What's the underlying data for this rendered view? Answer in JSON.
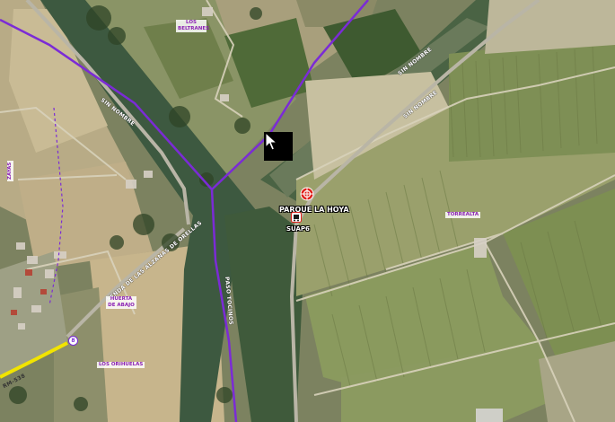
{
  "map": {
    "road_labels": {
      "sin_nombre_1": "SIN NOMBRE",
      "sin_nombre_2": "SIN NOMBRE",
      "sin_nombre_3": "SIN NOMBRE",
      "paso_tocinos": "PASO TOCINOS",
      "senda_alzanas": "SENDA DE LAS ALZANAS DE ORELLAS",
      "rm": "RM-538"
    },
    "place_labels": {
      "los_beltranes": "LOS BELTRANES",
      "torrealta": "TORREALTA",
      "hueta_abajo": "HUERTA DE ABAJO",
      "orihuelas": "LOS ORIHUELAS",
      "vertical_left": "ZAYAS"
    },
    "poi": {
      "parque_name": "PARQUE LA HOYA",
      "bus_stop": "SUAP6"
    },
    "route_number": "8",
    "colors": {
      "route": "#7b2bd6",
      "highway": "#f2e400",
      "poi_red": "#e0201b",
      "place_label": "#8a1fb3"
    },
    "icons": [
      "target-marker-icon",
      "bus-stop-icon",
      "cursor-arrow-icon"
    ]
  }
}
